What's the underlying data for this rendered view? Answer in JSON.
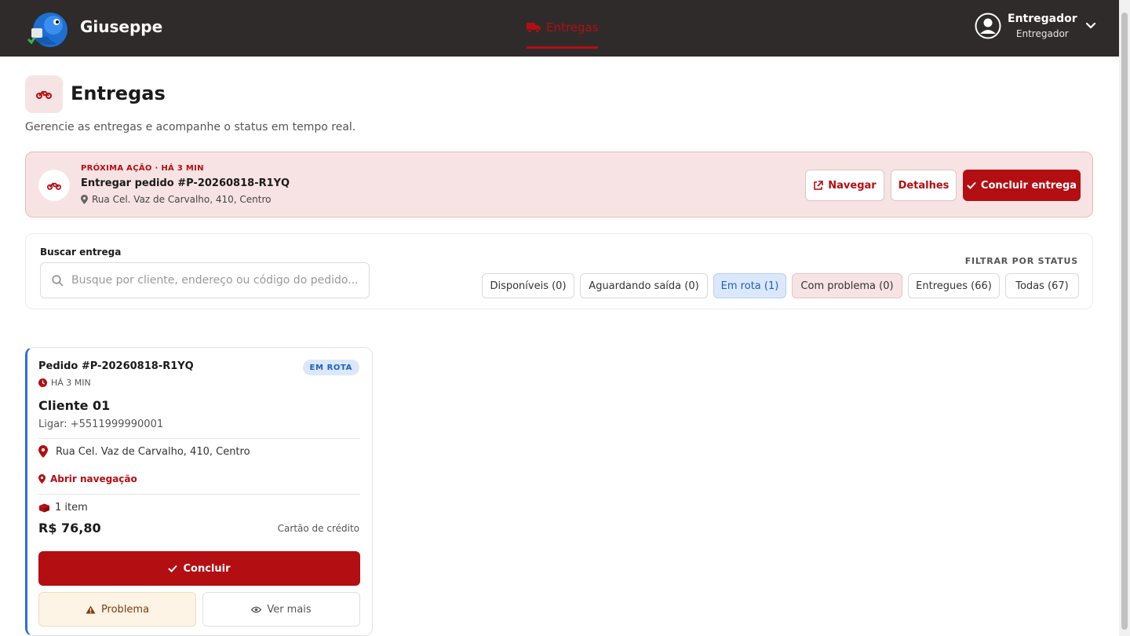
{
  "app": {
    "brand": "Giuseppe"
  },
  "nav": {
    "tabs": [
      {
        "label": "Entregas",
        "icon": "truck-icon",
        "active": true
      }
    ]
  },
  "user": {
    "name": "Entregador",
    "role": "Entregador"
  },
  "header": {
    "title": "Entregas",
    "subtitle": "Gerencie as entregas e acompanhe o status em tempo real."
  },
  "next_action": {
    "kicker": "PRÓXIMA AÇÃO · HÁ 3 MIN",
    "title": "Entregar pedido #P-20260818-R1YQ",
    "address": "Rua Cel. Vaz de Carvalho, 410, Centro",
    "buttons": {
      "navigate": "Navegar",
      "details": "Detalhes",
      "conclude": "Concluir entrega"
    }
  },
  "search": {
    "label": "Buscar entrega",
    "placeholder": "Busque por cliente, endereço ou código do pedido...",
    "value": ""
  },
  "filters": {
    "title": "FILTRAR POR STATUS",
    "chips": [
      {
        "label": "Disponíveis (0)"
      },
      {
        "label": "Aguardando saída (0)"
      },
      {
        "label": "Em rota (1)",
        "active": true
      },
      {
        "label": "Com problema (0)"
      },
      {
        "label": "Entregues (66)"
      },
      {
        "label": "Todas (67)"
      }
    ]
  },
  "cards": [
    {
      "order": "Pedido #P-20260818-R1YQ",
      "badge": "EM ROTA",
      "time": "HÁ 3 MIN",
      "client": "Cliente 01",
      "phone": "Ligar: +5511999990001",
      "address": "Rua Cel. Vaz de Carvalho, 410, Centro",
      "nav_link": "Abrir navegação",
      "items": "1 item",
      "price": "R$ 76,80",
      "payment": "Cartão de crédito",
      "actions": {
        "conclude": "Concluir",
        "problem": "Problema",
        "more": "Ver mais"
      }
    }
  ],
  "colors": {
    "primary": "#b30e12",
    "topbar": "#2f2b2b",
    "info": "#1d5fc4",
    "card_accent": "#2c6fd6"
  }
}
